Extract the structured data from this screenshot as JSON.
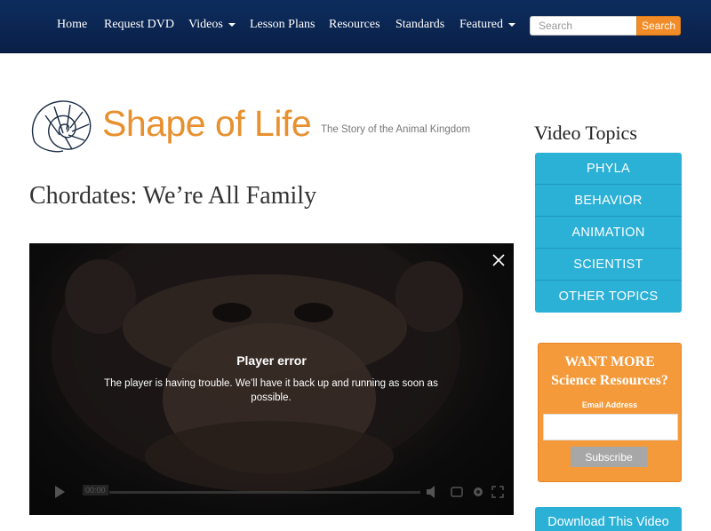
{
  "nav": {
    "items": [
      {
        "label": "Home",
        "dropdown": false
      },
      {
        "label": "Request DVD",
        "dropdown": false
      },
      {
        "label": "Videos",
        "dropdown": true
      },
      {
        "label": "Lesson Plans",
        "dropdown": false
      },
      {
        "label": "Resources",
        "dropdown": false
      },
      {
        "label": "Standards",
        "dropdown": false
      },
      {
        "label": "Featured",
        "dropdown": true
      }
    ],
    "search_placeholder": "Search",
    "search_button": "Search"
  },
  "logo": {
    "wordmark": "Shape of Life",
    "tagline": "The Story of the Animal Kingdom"
  },
  "page_title": "Chordates: We’re All Family",
  "player": {
    "error_title": "Player error",
    "error_message": "The player is having trouble. We’ll have it back up and running as soon as possible.",
    "time": "00:00"
  },
  "sidebar": {
    "heading": "Video Topics",
    "topics": [
      "PHYLA",
      "BEHAVIOR",
      "ANIMATION",
      "SCIENTIST",
      "OTHER TOPICS"
    ],
    "signup": {
      "title_line1": "WANT MORE",
      "title_line2": "Science Resources?",
      "email_label": "Email Address",
      "email_value": "",
      "subscribe_label": "Subscribe"
    },
    "download_label": "Download This Video"
  },
  "colors": {
    "nav_bg": "#0a1f47",
    "accent_orange": "#f28c28",
    "topic_blue": "#2bb0d6",
    "signup_orange": "#f49a3a",
    "logo_orange": "#e8902e"
  }
}
